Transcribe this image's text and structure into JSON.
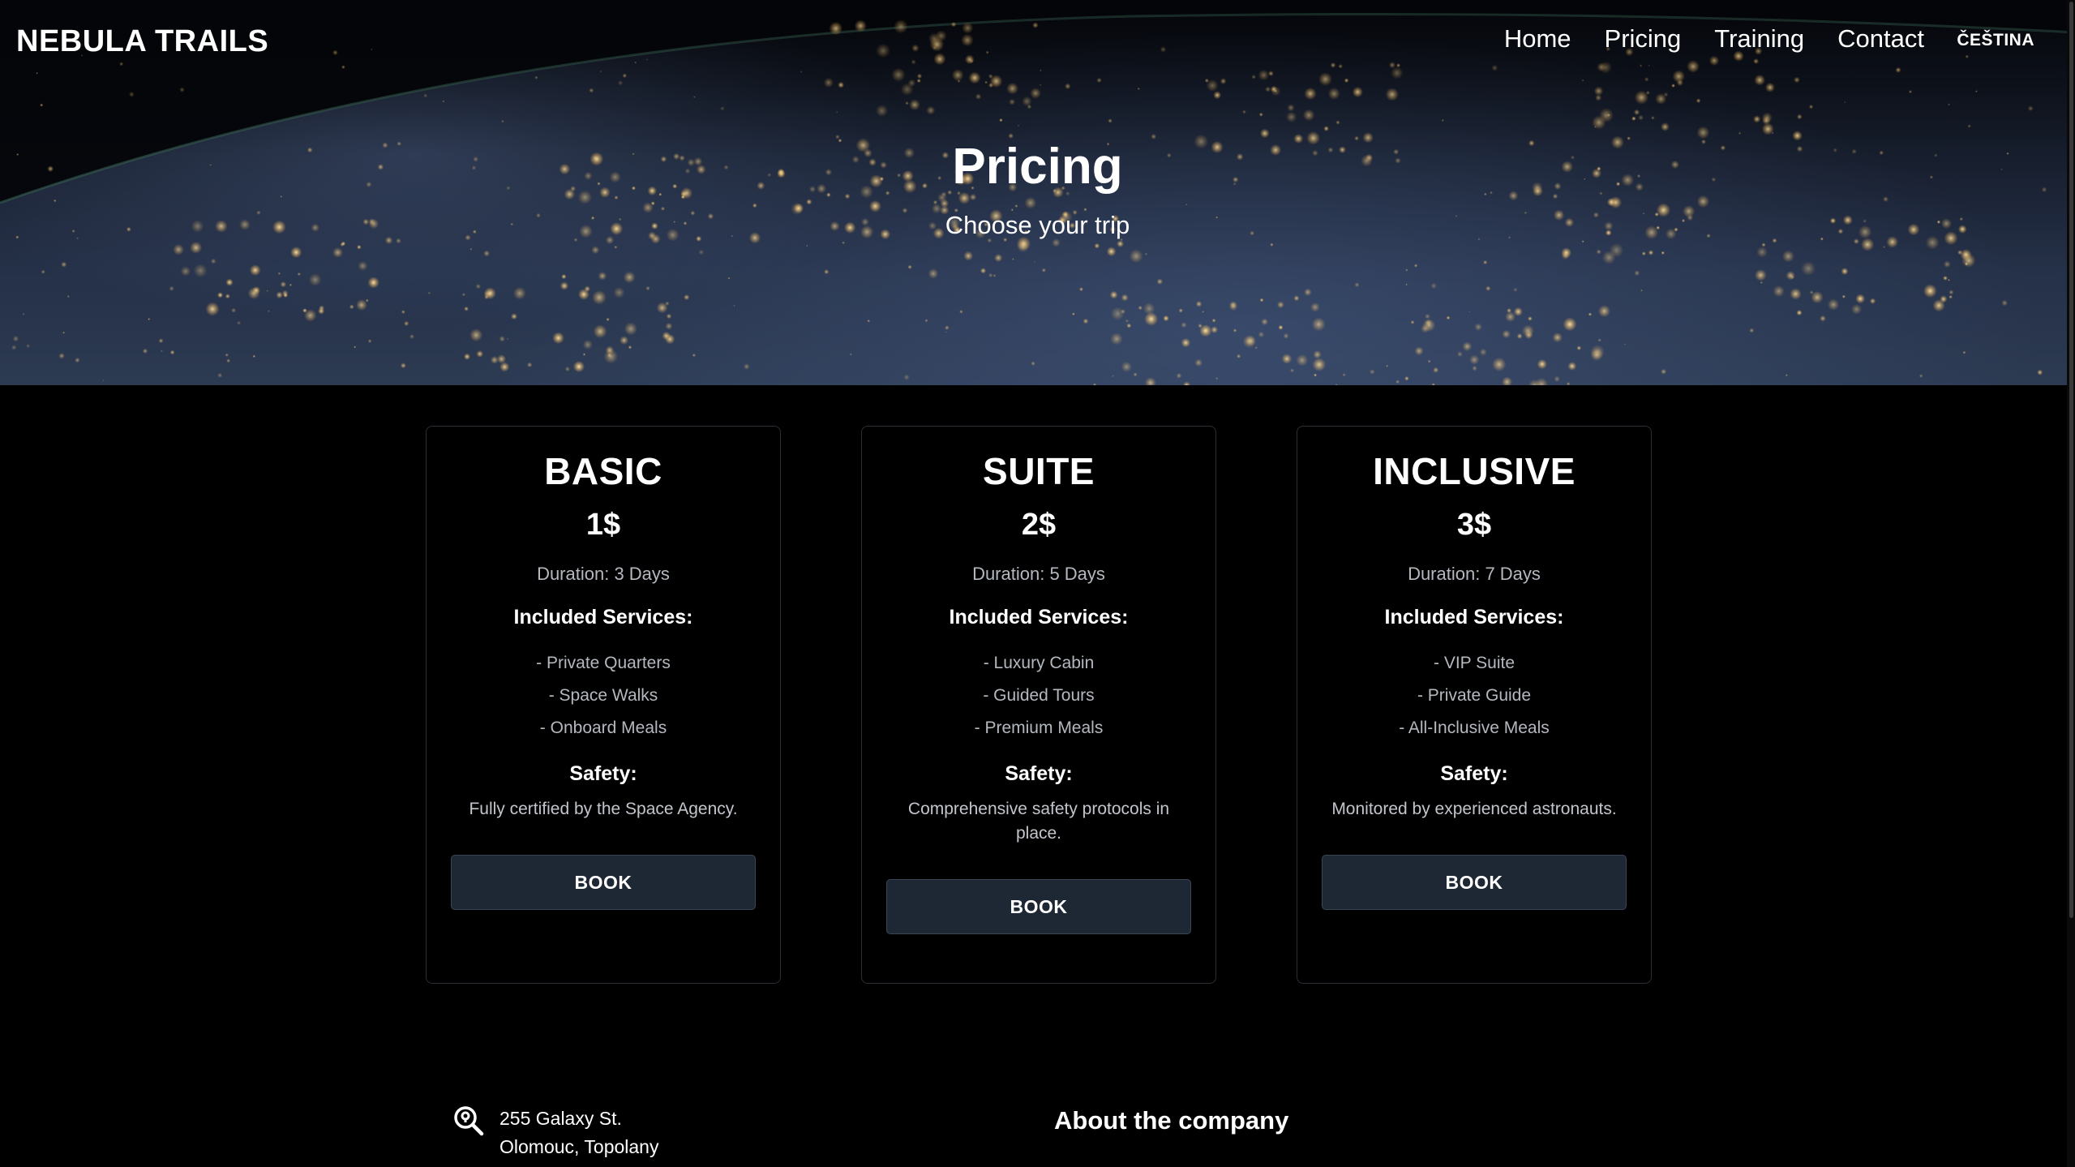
{
  "header": {
    "brand": "NEBULA TRAILS",
    "nav": [
      "Home",
      "Pricing",
      "Training",
      "Contact"
    ],
    "language": "ČEŠTINA"
  },
  "hero": {
    "title": "Pricing",
    "subtitle": "Choose your trip"
  },
  "plans": [
    {
      "name": "BASIC",
      "price": "1$",
      "duration": "Duration: 3 Days",
      "included_heading": "Included Services:",
      "services": [
        "- Private Quarters",
        "- Space Walks",
        "- Onboard Meals"
      ],
      "safety_heading": "Safety:",
      "safety_text": "Fully certified by the Space Agency.",
      "button": "BOOK"
    },
    {
      "name": "SUITE",
      "price": "2$",
      "duration": "Duration: 5 Days",
      "included_heading": "Included Services:",
      "services": [
        "- Luxury Cabin",
        "- Guided Tours",
        "- Premium Meals"
      ],
      "safety_heading": "Safety:",
      "safety_text": "Comprehensive safety protocols in place.",
      "button": "BOOK"
    },
    {
      "name": "INCLUSIVE",
      "price": "3$",
      "duration": "Duration: 7 Days",
      "included_heading": "Included Services:",
      "services": [
        "- VIP Suite",
        "- Private Guide",
        "- All-Inclusive Meals"
      ],
      "safety_heading": "Safety:",
      "safety_text": "Monitored by experienced astronauts.",
      "button": "BOOK"
    }
  ],
  "footer": {
    "address_icon": "location-search-icon",
    "address_line1": "255 Galaxy St.",
    "address_line2": "Olomouc, Topolany",
    "about_heading": "About the company"
  },
  "colors": {
    "background": "#000000",
    "card_border": "#2a2f36",
    "button_bg": "#1e2835",
    "muted_text": "#b4b8bf"
  }
}
